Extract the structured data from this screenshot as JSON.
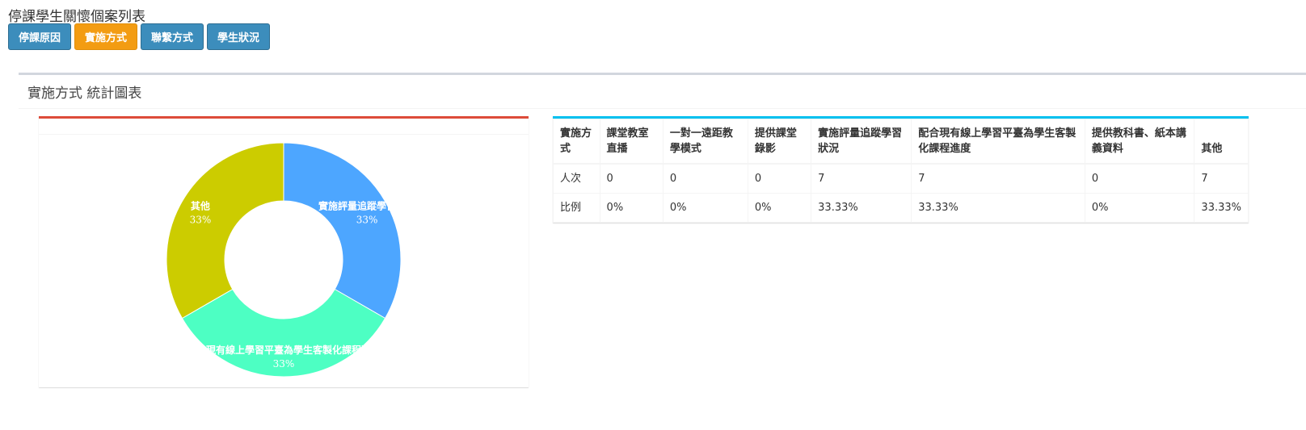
{
  "page": {
    "title": "停課學生關懷個案列表"
  },
  "tabs": [
    {
      "label": "停課原因",
      "active": false
    },
    {
      "label": "實施方式",
      "active": true
    },
    {
      "label": "聯繫方式",
      "active": false
    },
    {
      "label": "學生狀況",
      "active": false
    }
  ],
  "section": {
    "title": "實施方式 統計圖表"
  },
  "chart_data": {
    "type": "pie",
    "slices": [
      {
        "label": "實施評量追蹤學習狀況",
        "value": 7,
        "percent": "33%",
        "color": "#4da6ff"
      },
      {
        "label": "配合現有線上學習平臺為學生客製化課程進度",
        "value": 7,
        "percent": "33%",
        "color": "#4dffc3"
      },
      {
        "label": "其他",
        "value": 7,
        "percent": "33%",
        "color": "#cccc00"
      }
    ],
    "donut": true
  },
  "table": {
    "headers": [
      "實施方式",
      "課堂教室直播",
      "一對一遠距教學模式",
      "提供課堂錄影",
      "實施評量追蹤學習狀況",
      "配合現有線上學習平臺為學生客製化課程進度",
      "提供教科書、紙本講義資料",
      "其他"
    ],
    "rows": [
      [
        "人次",
        "0",
        "0",
        "0",
        "7",
        "7",
        "0",
        "7"
      ],
      [
        "比例",
        "0%",
        "0%",
        "0%",
        "33.33%",
        "33.33%",
        "0%",
        "33.33%"
      ]
    ]
  }
}
